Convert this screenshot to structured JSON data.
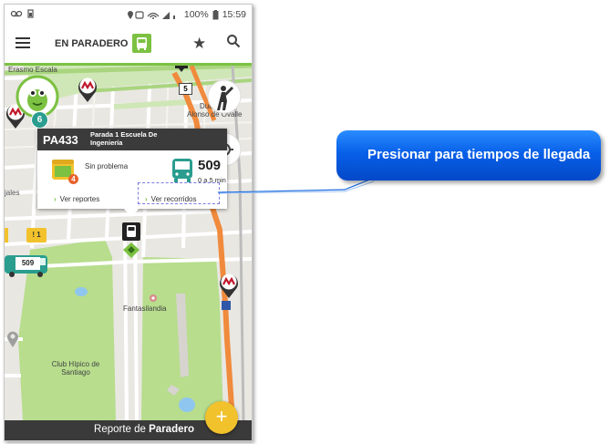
{
  "status_bar": {
    "left_icons": "voicemail, battery-saver",
    "battery": "100%",
    "time": "15:59"
  },
  "app_bar": {
    "title": "EN PARADERO"
  },
  "map": {
    "labels": {
      "erasmo": "Erasmo Escala",
      "duc": "Duc",
      "alonso": "Alonso de Ovalle",
      "fantasilandia": "Fantasilandia",
      "club_hipico": "Club Hípico de Santiago",
      "jales": "jales"
    },
    "road_shields": {
      "five": "5"
    },
    "avatar_count": "6",
    "ticket_label": "! 1",
    "bus_number": "509"
  },
  "stop_popup": {
    "code": "PA433",
    "name": "Parada 1 Escuela De Ingeniería",
    "report_count": "4",
    "status": "Sin problema",
    "route": "509",
    "eta": "0 a 5 min",
    "reports_link": "Ver reportes",
    "routes_link": "Ver recorridos"
  },
  "callout": {
    "text": "Presionar para tiempos de llegada"
  },
  "bottom_bar": {
    "prefix": "Reporte de ",
    "bold": "Paradero",
    "fab": "+"
  },
  "colors": {
    "accent_green": "#7cc142",
    "route_orange": "#f08a3c",
    "callout_blue": "#0a5fe6",
    "metro_red": "#c0172b"
  }
}
